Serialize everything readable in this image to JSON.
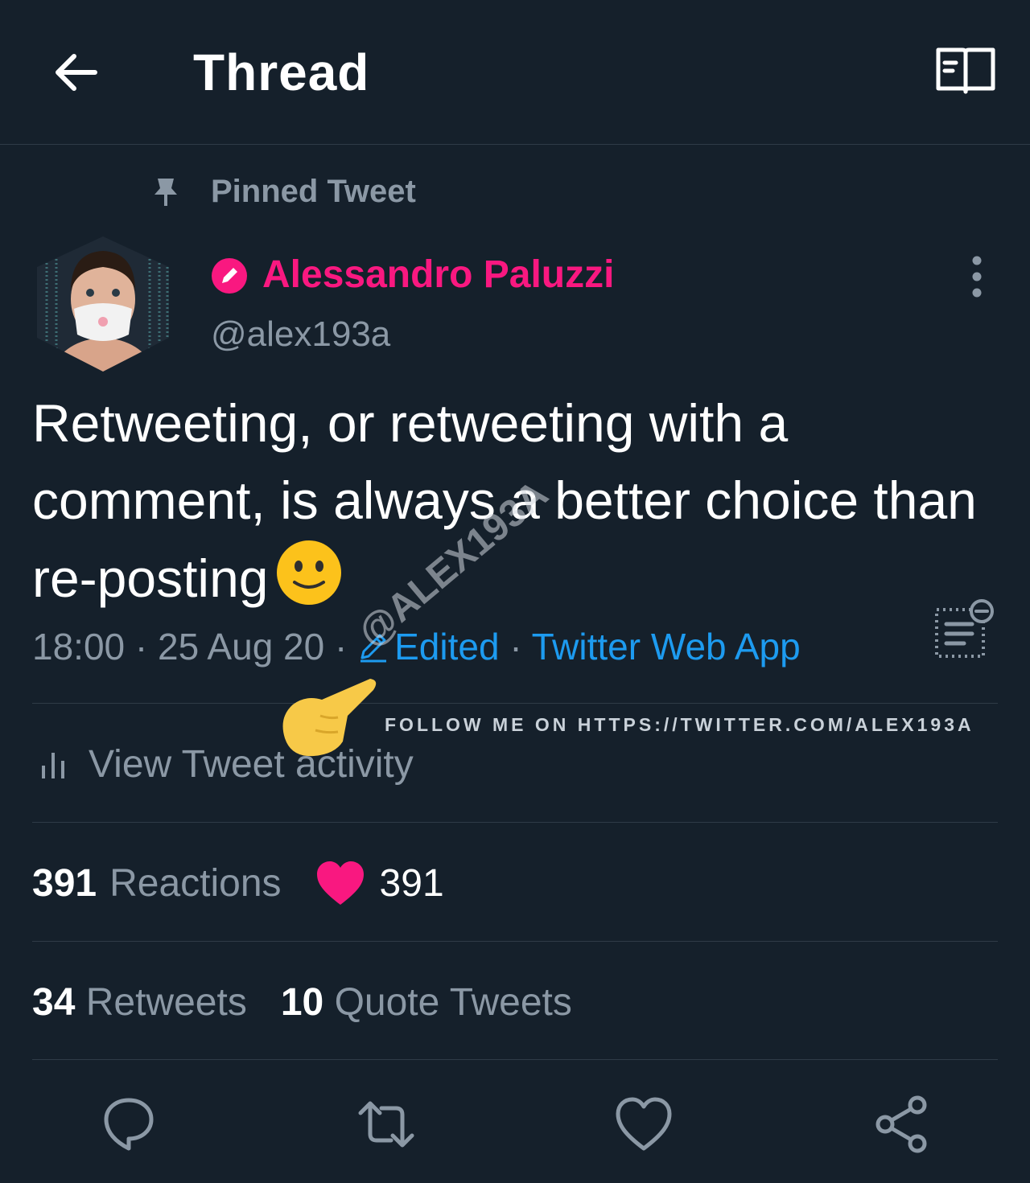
{
  "header": {
    "title": "Thread"
  },
  "pinned": {
    "label": "Pinned Tweet"
  },
  "author": {
    "name": "Alessandro Paluzzi",
    "handle": "@alex193a"
  },
  "tweet": {
    "text": "Retweeting, or retweeting with a comment, is always a better choice than re-posting",
    "time": "18:00",
    "separator1": " · ",
    "date": "25 Aug 20",
    "separator2": " · ",
    "edited": "Edited",
    "separator3": " · ",
    "source": "Twitter Web App"
  },
  "activity": {
    "label": "View Tweet activity"
  },
  "stats": {
    "reactions_count": "391",
    "reactions_label": "Reactions",
    "likes_count": "391",
    "retweets_count": "34",
    "retweets_label": "Retweets",
    "quotes_count": "10",
    "quotes_label": "Quote Tweets"
  },
  "watermark": {
    "tag": "@ALEX193A",
    "follow": "FOLLOW ME ON HTTPS://TWITTER.COM/ALEX193A"
  },
  "colors": {
    "background": "#15202b",
    "accent_blue": "#1d9bf0",
    "accent_pink": "#f91880",
    "muted": "#8b98a5"
  }
}
